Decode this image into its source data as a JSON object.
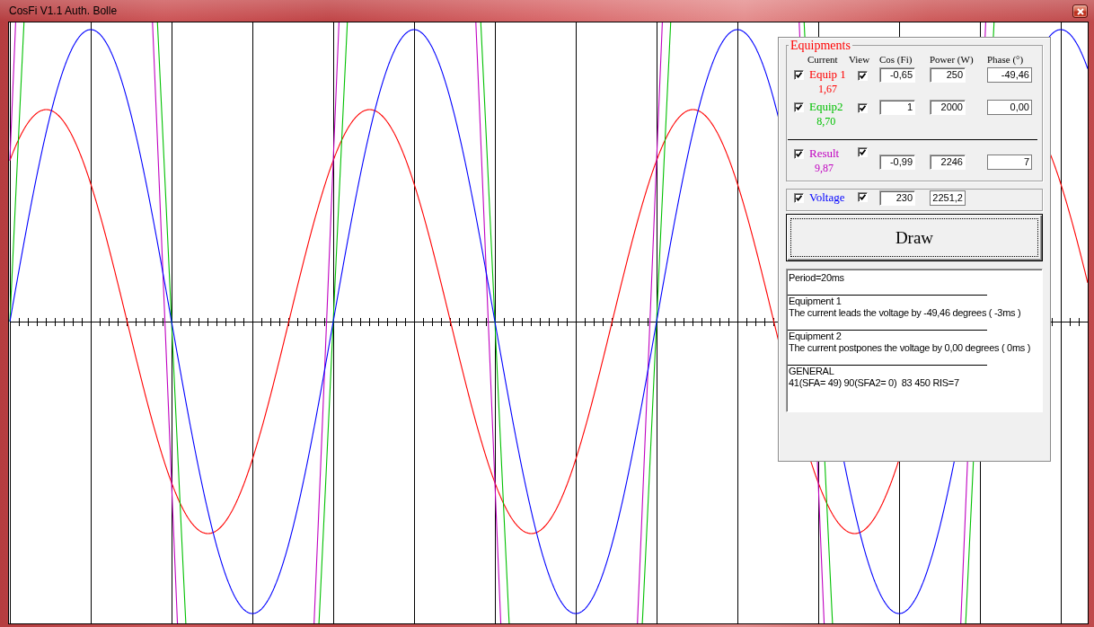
{
  "window": {
    "title": "CosFi V1.1 Auth. Bolle"
  },
  "equipments": {
    "title": "Equipments",
    "columns": [
      "Current",
      "View",
      "Cos (Fi)",
      "Power (W)",
      "Phase (°)"
    ],
    "rows": [
      {
        "kind": "equipment",
        "name": "Equip 1",
        "current": "1,67",
        "color": "#ff0000",
        "enabled": true,
        "view": true,
        "cos_fi": "-0,65",
        "power": "250",
        "phase": "-49,46"
      },
      {
        "kind": "equipment",
        "name": "Equip2",
        "current": "8,70",
        "color": "#00c000",
        "enabled": true,
        "view": true,
        "cos_fi": "1",
        "power": "2000",
        "phase": "0,00"
      },
      {
        "kind": "result",
        "name": "Result",
        "current": "9,87",
        "color": "#c000c0",
        "enabled": true,
        "view": true,
        "cos_fi": "-0,99",
        "power": "2246",
        "phase": "7"
      }
    ]
  },
  "voltage": {
    "name": "Voltage",
    "color": "#0000ff",
    "enabled": true,
    "view": true,
    "value": "230",
    "apparent_power": "2251,2"
  },
  "draw_button": {
    "label": "Draw"
  },
  "log": {
    "header": "Period=20ms",
    "sections": [
      {
        "title": "Equipment 1",
        "text": "The current leads the voltage by -49,46 degrees ( -3ms )"
      },
      {
        "title": "Equipment 2",
        "text": "The current postpones the voltage by 0,00 degrees ( 0ms )"
      },
      {
        "title": "GENERAL",
        "text": "41(SFA= 49) 90(SFA2= 0)  83 450 RIS=7"
      }
    ]
  }
}
